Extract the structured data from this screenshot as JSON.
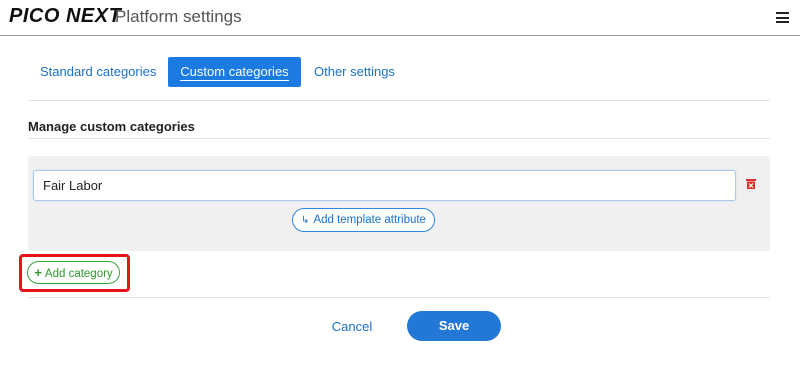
{
  "header": {
    "logo": "PICO NEXT",
    "title": "Platform settings",
    "menu_icon": "hamburger-menu-icon"
  },
  "tabs": [
    {
      "label": "Standard categories",
      "active": false
    },
    {
      "label": "Custom categories",
      "active": true
    },
    {
      "label": "Other settings",
      "active": false
    }
  ],
  "section": {
    "title": "Manage custom categories"
  },
  "category": {
    "name_value": "Fair Labor",
    "delete_icon": "trash-icon",
    "add_attribute_icon": "return-arrow-icon",
    "add_attribute_label": "Add template attribute"
  },
  "add_category": {
    "icon": "plus-icon",
    "label": "Add category"
  },
  "footer": {
    "cancel_label": "Cancel",
    "save_label": "Save"
  },
  "colors": {
    "accent": "#1c7be0",
    "add_category_green": "#2c9a2c",
    "delete_red": "#d9302c",
    "highlight_red": "#e8121a"
  }
}
